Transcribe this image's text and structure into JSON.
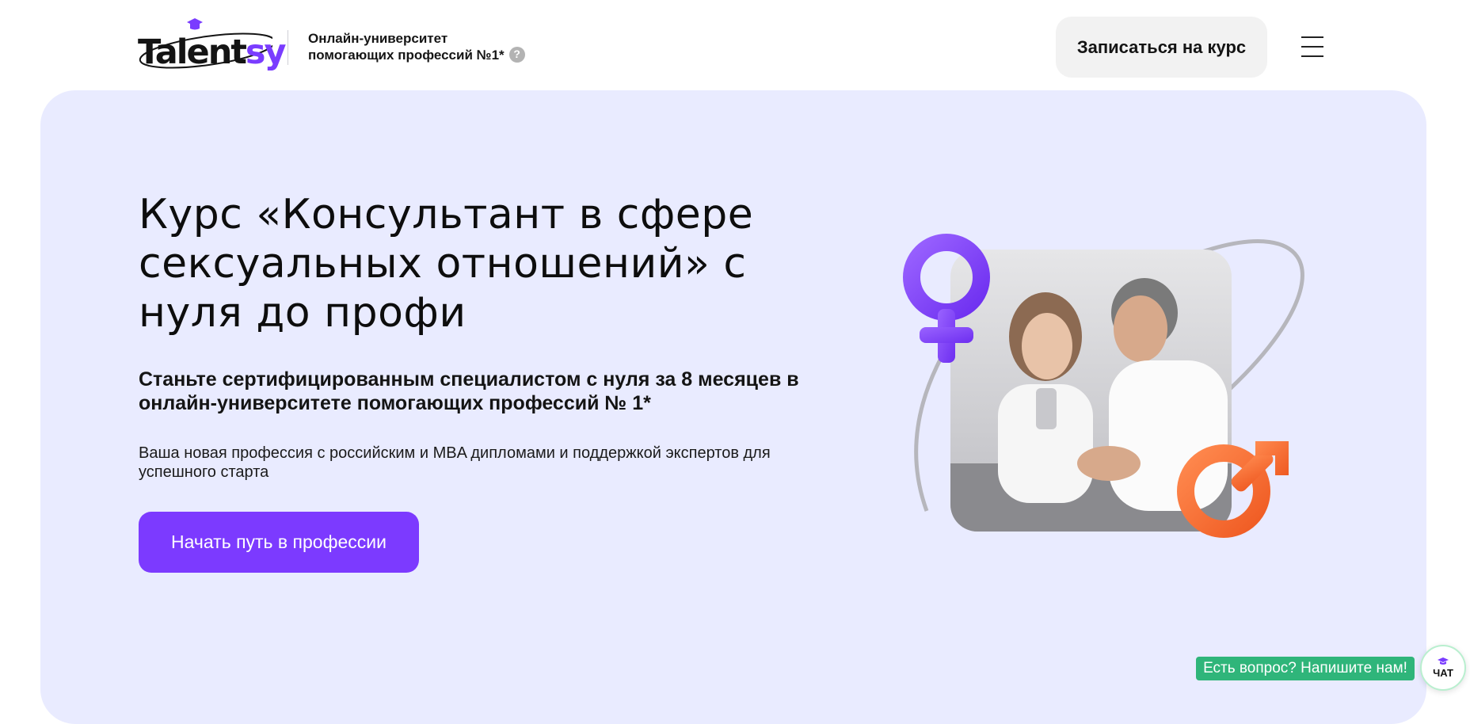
{
  "header": {
    "logo": {
      "text_main": "Talent",
      "text_accent": "sy"
    },
    "tagline": "Онлайн-университет помогающих профессий №1*",
    "help_icon": "?",
    "enroll_button": "Записаться на курс",
    "menu_icon": "hamburger-menu-icon"
  },
  "hero": {
    "title": "Курс «Консультант в сфере сексуальных отношений» с нуля до профи",
    "subtitle": "Станьте сертифицированным специалистом с нуля за 8 месяцев в онлайн-университете помогающих профессий № 1*",
    "description": "Ваша новая профессия с российским и MBA дипломами и поддержкой экспертов для успешного старта",
    "cta_button": "Начать путь в профессии"
  },
  "chat": {
    "prompt": "Есть вопрос? Напишите нам!",
    "button_label": "ЧАТ"
  },
  "colors": {
    "accent": "#7c3aff",
    "hero_bg": "#e9ebff",
    "chat_green": "#2fb57a",
    "male_symbol": "#ff6a2e",
    "female_symbol": "#8b4dff"
  }
}
